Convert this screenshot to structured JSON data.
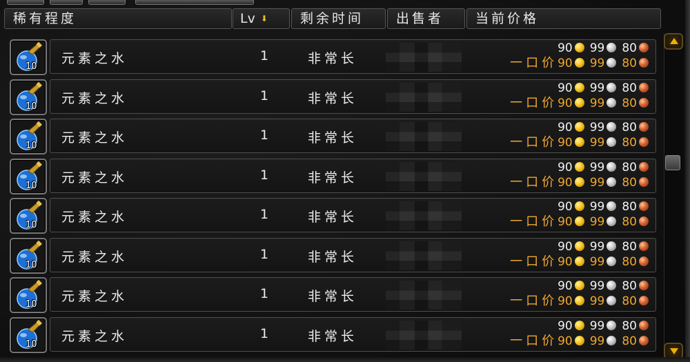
{
  "header": {
    "rarity": "稀有程度",
    "level": "Lv",
    "time_left": "剩余时间",
    "seller": "出售者",
    "current_price": "当前价格"
  },
  "sort_indicator": "descending-arrow",
  "buyout_label": "一口价",
  "rows": [
    {
      "name": "元素之水",
      "count": "10",
      "level": "1",
      "time": "非常长",
      "bid": {
        "gold": "90",
        "silver": "99",
        "copper": "80"
      },
      "buyout": {
        "gold": "90",
        "silver": "99",
        "copper": "80"
      }
    },
    {
      "name": "元素之水",
      "count": "10",
      "level": "1",
      "time": "非常长",
      "bid": {
        "gold": "90",
        "silver": "99",
        "copper": "80"
      },
      "buyout": {
        "gold": "90",
        "silver": "99",
        "copper": "80"
      }
    },
    {
      "name": "元素之水",
      "count": "10",
      "level": "1",
      "time": "非常长",
      "bid": {
        "gold": "90",
        "silver": "99",
        "copper": "80"
      },
      "buyout": {
        "gold": "90",
        "silver": "99",
        "copper": "80"
      }
    },
    {
      "name": "元素之水",
      "count": "10",
      "level": "1",
      "time": "非常长",
      "bid": {
        "gold": "90",
        "silver": "99",
        "copper": "80"
      },
      "buyout": {
        "gold": "90",
        "silver": "99",
        "copper": "80"
      }
    },
    {
      "name": "元素之水",
      "count": "10",
      "level": "1",
      "time": "非常长",
      "bid": {
        "gold": "90",
        "silver": "99",
        "copper": "80"
      },
      "buyout": {
        "gold": "90",
        "silver": "99",
        "copper": "80"
      }
    },
    {
      "name": "元素之水",
      "count": "10",
      "level": "1",
      "time": "非常长",
      "bid": {
        "gold": "90",
        "silver": "99",
        "copper": "80"
      },
      "buyout": {
        "gold": "90",
        "silver": "99",
        "copper": "80"
      }
    },
    {
      "name": "元素之水",
      "count": "10",
      "level": "1",
      "time": "非常长",
      "bid": {
        "gold": "90",
        "silver": "99",
        "copper": "80"
      },
      "buyout": {
        "gold": "90",
        "silver": "99",
        "copper": "80"
      }
    },
    {
      "name": "元素之水",
      "count": "10",
      "level": "1",
      "time": "非常长",
      "bid": {
        "gold": "90",
        "silver": "99",
        "copper": "80"
      },
      "buyout": {
        "gold": "90",
        "silver": "99",
        "copper": "80"
      }
    }
  ],
  "colors": {
    "buyout": "#f0a830",
    "gold_coin": "#f6c21c",
    "silver_coin": "#c8c8c8",
    "copper_coin": "#d3612e",
    "scroll_arrow": "#f0b000"
  },
  "icons": {
    "item": "potion-flask-icon",
    "scroll_up": "scroll-up-icon",
    "scroll_down": "scroll-down-icon"
  }
}
